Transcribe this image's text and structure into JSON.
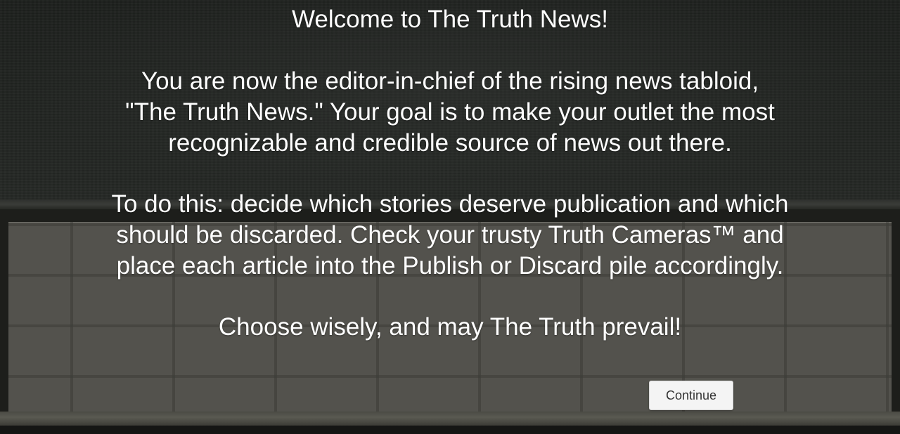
{
  "intro": {
    "title": "Welcome to The Truth News!",
    "paragraph1": [
      "You are now the editor-in-chief of the rising news tabloid,",
      "\"The Truth News.\" Your goal is to make your outlet the most",
      "recognizable and credible source of news out there."
    ],
    "paragraph2": [
      "To do this: decide which stories deserve publication and which",
      "should be discarded. Check your trusty Truth Cameras™ and",
      "place each article into the Publish or Discard pile accordingly."
    ],
    "closing": "Choose wisely, and may The Truth prevail!"
  },
  "buttons": {
    "continue_label": "Continue"
  },
  "colors": {
    "text": "#ffffff",
    "button_bg": "#f4f4f4",
    "button_text": "#333333"
  }
}
